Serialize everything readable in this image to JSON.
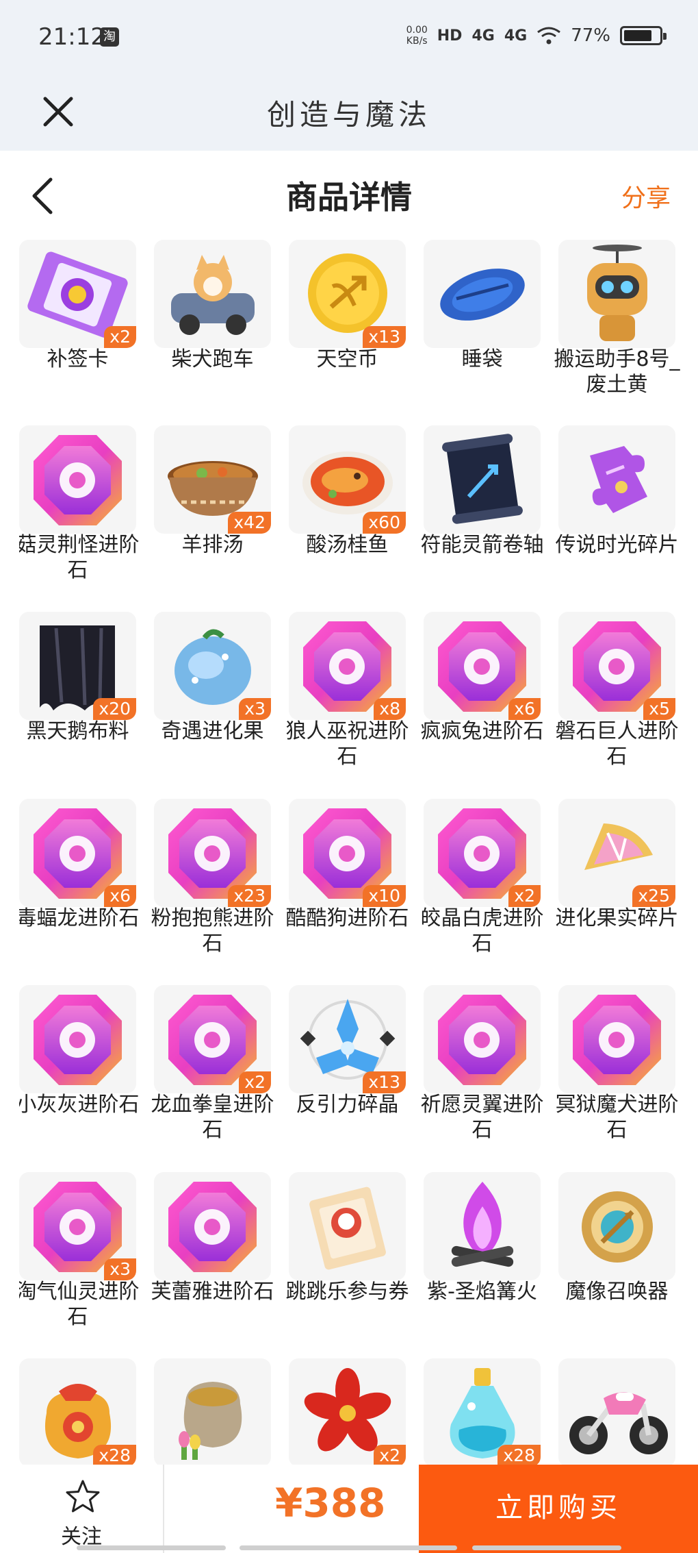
{
  "status": {
    "time": "21:12",
    "app_badge": "淘",
    "speed_value": "0.00",
    "speed_unit": "KB/s",
    "hd": "HD",
    "net1": "4G",
    "net2": "4G",
    "battery": "77%"
  },
  "miniapp": {
    "title": "创造与魔法"
  },
  "nav": {
    "title": "商品详情",
    "share": "分享"
  },
  "items": [
    {
      "name": "补签卡",
      "qty": "x2",
      "icon": "ticket-icon"
    },
    {
      "name": "柴犬跑车",
      "qty": "",
      "icon": "shiba-car-icon"
    },
    {
      "name": "天空币",
      "qty": "x13",
      "icon": "sky-coin-icon"
    },
    {
      "name": "睡袋",
      "qty": "",
      "icon": "sleeping-bag-icon"
    },
    {
      "name": "搬运助手8号_废土黄",
      "qty": "",
      "icon": "robot-icon"
    },
    {
      "name": "菇灵荆怪进阶石",
      "qty": "",
      "icon": "gem-icon"
    },
    {
      "name": "羊排汤",
      "qty": "x42",
      "icon": "soup-icon"
    },
    {
      "name": "酸汤桂鱼",
      "qty": "x60",
      "icon": "fish-dish-icon"
    },
    {
      "name": "符能灵箭卷轴",
      "qty": "",
      "icon": "scroll-icon"
    },
    {
      "name": "传说时光碎片",
      "qty": "",
      "icon": "puzzle-icon"
    },
    {
      "name": "黑天鹅布料",
      "qty": "x20",
      "icon": "cloth-icon"
    },
    {
      "name": "奇遇进化果",
      "qty": "x3",
      "icon": "fruit-icon"
    },
    {
      "name": "狼人巫祝进阶石",
      "qty": "x8",
      "icon": "gem-icon"
    },
    {
      "name": "疯疯兔进阶石",
      "qty": "x6",
      "icon": "gem-icon"
    },
    {
      "name": "磐石巨人进阶石",
      "qty": "x5",
      "icon": "gem-icon"
    },
    {
      "name": "毒蝠龙进阶石",
      "qty": "x6",
      "icon": "gem-icon"
    },
    {
      "name": "粉抱抱熊进阶石",
      "qty": "x23",
      "icon": "gem-icon"
    },
    {
      "name": "酷酷狗进阶石",
      "qty": "x10",
      "icon": "gem-icon"
    },
    {
      "name": "皎晶白虎进阶石",
      "qty": "x2",
      "icon": "gem-icon"
    },
    {
      "name": "进化果实碎片",
      "qty": "x25",
      "icon": "fruit-shard-icon"
    },
    {
      "name": "小灰灰进阶石",
      "qty": "",
      "icon": "gem-icon"
    },
    {
      "name": "龙血拳皇进阶石",
      "qty": "x2",
      "icon": "gem-icon"
    },
    {
      "name": "反引力碎晶",
      "qty": "x13",
      "icon": "crystal-icon"
    },
    {
      "name": "祈愿灵翼进阶石",
      "qty": "",
      "icon": "gem-icon"
    },
    {
      "name": "冥狱魔犬进阶石",
      "qty": "",
      "icon": "gem-icon"
    },
    {
      "name": "淘气仙灵进阶石",
      "qty": "x3",
      "icon": "gem-icon"
    },
    {
      "name": "芙蕾雅进阶石",
      "qty": "",
      "icon": "gem-icon"
    },
    {
      "name": "跳跳乐参与券",
      "qty": "",
      "icon": "coupon-icon"
    },
    {
      "name": "紫-圣焰篝火",
      "qty": "",
      "icon": "bonfire-icon"
    },
    {
      "name": "魔像召唤器",
      "qty": "",
      "icon": "compass-icon"
    },
    {
      "name": "",
      "qty": "x28",
      "icon": "lucky-bag-icon"
    },
    {
      "name": "",
      "qty": "",
      "icon": "seed-bag-icon"
    },
    {
      "name": "",
      "qty": "x2",
      "icon": "flower-icon"
    },
    {
      "name": "",
      "qty": "x28",
      "icon": "potion-icon"
    },
    {
      "name": "",
      "qty": "",
      "icon": "motorbike-icon"
    }
  ],
  "bottom": {
    "follow_label": "关注",
    "price": "¥388",
    "buy_label": "立即购买"
  },
  "colors": {
    "accent": "#f27227",
    "buy": "#fc5a10",
    "gem_pink": "#e83fc2",
    "gem_gold": "#f7b42c",
    "gem_purple": "#8b3fe0"
  }
}
